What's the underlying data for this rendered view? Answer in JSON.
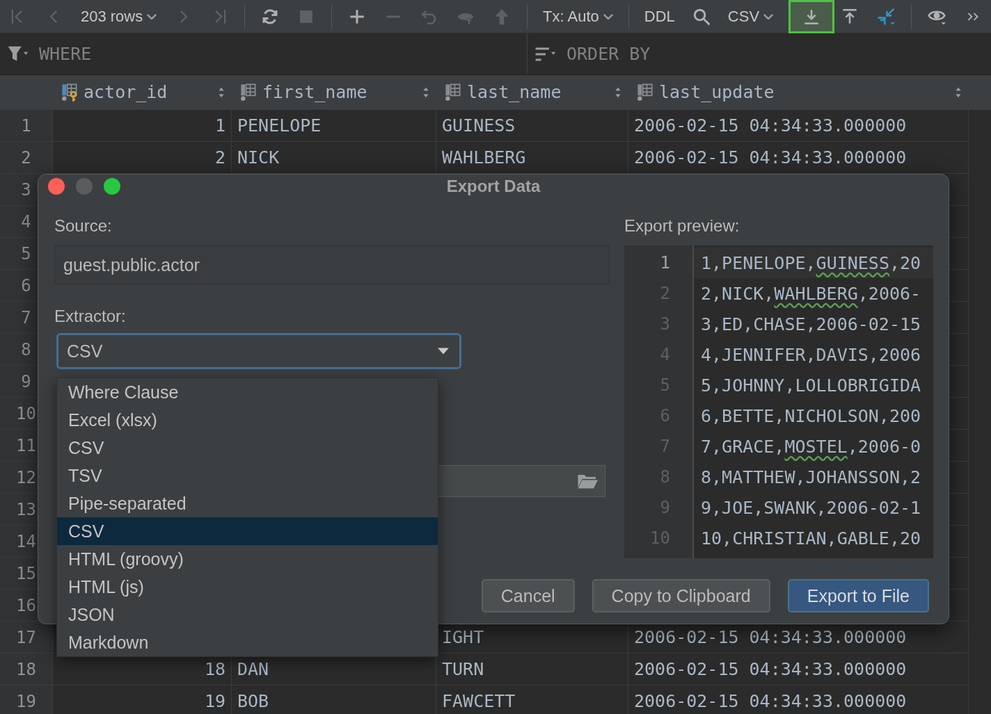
{
  "toolbar": [
    [
      {
        "kind": "first",
        "disabled": true,
        "highlighted": false
      },
      {
        "kind": "prev",
        "disabled": true,
        "highlighted": false
      },
      {
        "kind": "dropdown",
        "label": "203 rows",
        "disabled": false,
        "highlighted": false
      },
      {
        "kind": "next",
        "disabled": true,
        "highlighted": false
      },
      {
        "kind": "last",
        "disabled": true,
        "highlighted": false
      }
    ],
    [
      {
        "kind": "refresh",
        "disabled": false,
        "highlighted": false
      },
      {
        "kind": "stop",
        "disabled": true,
        "highlighted": false
      }
    ],
    [
      {
        "kind": "add",
        "disabled": false,
        "highlighted": false
      },
      {
        "kind": "remove",
        "disabled": true,
        "highlighted": false
      },
      {
        "kind": "undo",
        "disabled": true,
        "highlighted": false
      },
      {
        "kind": "preview",
        "disabled": true,
        "highlighted": false
      },
      {
        "kind": "submit",
        "disabled": true,
        "highlighted": false
      }
    ],
    [
      {
        "kind": "dropdown",
        "label": "Tx: Auto",
        "disabled": false,
        "highlighted": false
      }
    ],
    [
      {
        "kind": "text",
        "label": "DDL",
        "disabled": false,
        "highlighted": false
      },
      {
        "kind": "search",
        "disabled": false,
        "highlighted": false
      },
      {
        "kind": "dropdown",
        "label": "CSV",
        "disabled": false,
        "highlighted": false
      },
      {
        "kind": "download",
        "disabled": false,
        "highlighted": true
      },
      {
        "kind": "upload",
        "disabled": false,
        "highlighted": false
      },
      {
        "kind": "compare",
        "disabled": false,
        "highlighted": false
      }
    ],
    [
      {
        "kind": "view",
        "disabled": false,
        "highlighted": false
      },
      {
        "kind": "more",
        "disabled": false,
        "highlighted": false
      }
    ]
  ],
  "filter_bar": {
    "where": "WHERE",
    "order_by": "ORDER BY"
  },
  "table": {
    "columns": [
      {
        "name": "actor_id",
        "kind": "key"
      },
      {
        "name": "first_name",
        "kind": "plain"
      },
      {
        "name": "last_name",
        "kind": "plain"
      },
      {
        "name": "last_update",
        "kind": "plain"
      }
    ],
    "rows": [
      {
        "number": "1",
        "actor_id": "1",
        "first_name": "PENELOPE",
        "last_name": "GUINESS",
        "last_update": "2006-02-15 04:34:33.000000"
      },
      {
        "number": "2",
        "actor_id": "2",
        "first_name": "NICK",
        "last_name": "WAHLBERG",
        "last_update": "2006-02-15 04:34:33.000000"
      },
      {
        "number": "3"
      },
      {
        "number": "4"
      },
      {
        "number": "5"
      },
      {
        "number": "6"
      },
      {
        "number": "7"
      },
      {
        "number": "8"
      },
      {
        "number": "9"
      },
      {
        "number": "10"
      },
      {
        "number": "11"
      },
      {
        "number": "12"
      },
      {
        "number": "13"
      },
      {
        "number": "14"
      },
      {
        "number": "15"
      },
      {
        "number": "16"
      },
      {
        "number": "17",
        "last_name": "IGHT",
        "last_update": "2006-02-15 04:34:33.000000"
      },
      {
        "number": "18",
        "actor_id": "18",
        "first_name": "DAN",
        "last_name": "TURN",
        "last_update": "2006-02-15 04:34:33.000000"
      },
      {
        "number": "19",
        "actor_id": "19",
        "first_name": "BOB",
        "last_name": "FAWCETT",
        "last_update": "2006-02-15 04:34:33.000000"
      }
    ]
  },
  "dialog": {
    "title": "Export Data",
    "source_label": "Source:",
    "source_value": "guest.public.actor",
    "extractor_label": "Extractor:",
    "extractor_value": "CSV",
    "extractor_options": [
      {
        "label": "Where Clause",
        "selected": false
      },
      {
        "label": "Excel (xlsx)",
        "selected": false
      },
      {
        "label": "CSV",
        "selected": false
      },
      {
        "label": "TSV",
        "selected": false
      },
      {
        "label": "Pipe-separated",
        "selected": false
      },
      {
        "label": "CSV",
        "selected": true
      },
      {
        "label": "HTML (groovy)",
        "selected": false
      },
      {
        "label": "HTML (js)",
        "selected": false
      },
      {
        "label": "JSON",
        "selected": false
      },
      {
        "label": "Markdown",
        "selected": false
      }
    ],
    "preview_label": "Export preview:",
    "preview_lines": [
      {
        "number": "1",
        "current": true,
        "segments": [
          {
            "text": "1,PENELOPE,",
            "typo": false
          },
          {
            "text": "GUINESS",
            "typo": true
          },
          {
            "text": ",20",
            "typo": false
          }
        ]
      },
      {
        "number": "2",
        "current": false,
        "segments": [
          {
            "text": "2,NICK,",
            "typo": false
          },
          {
            "text": "WAHLBERG",
            "typo": true
          },
          {
            "text": ",2006-",
            "typo": false
          }
        ]
      },
      {
        "number": "3",
        "current": false,
        "segments": [
          {
            "text": "3,ED,CHASE,2006-02-15",
            "typo": false
          }
        ]
      },
      {
        "number": "4",
        "current": false,
        "segments": [
          {
            "text": "4,JENNIFER,DAVIS,2006",
            "typo": false
          }
        ]
      },
      {
        "number": "5",
        "current": false,
        "segments": [
          {
            "text": "5,JOHNNY,LOLLOBRIGIDA",
            "typo": false
          }
        ]
      },
      {
        "number": "6",
        "current": false,
        "segments": [
          {
            "text": "6,BETTE,NICHOLSON,200",
            "typo": false
          }
        ]
      },
      {
        "number": "7",
        "current": false,
        "segments": [
          {
            "text": "7,GRACE,",
            "typo": false
          },
          {
            "text": "MOSTEL",
            "typo": true
          },
          {
            "text": ",2006-0",
            "typo": false
          }
        ]
      },
      {
        "number": "8",
        "current": false,
        "segments": [
          {
            "text": "8,MATTHEW,JOHANSSON,2",
            "typo": false
          }
        ]
      },
      {
        "number": "9",
        "current": false,
        "segments": [
          {
            "text": "9,JOE,SWANK,2006-02-1",
            "typo": false
          }
        ]
      },
      {
        "number": "10",
        "current": false,
        "segments": [
          {
            "text": "10,CHRISTIAN,GABLE,20",
            "typo": false
          }
        ]
      }
    ],
    "buttons": [
      {
        "label": "Cancel",
        "primary": false
      },
      {
        "label": "Copy to Clipboard",
        "primary": false
      },
      {
        "label": "Export to File",
        "primary": true
      }
    ]
  }
}
